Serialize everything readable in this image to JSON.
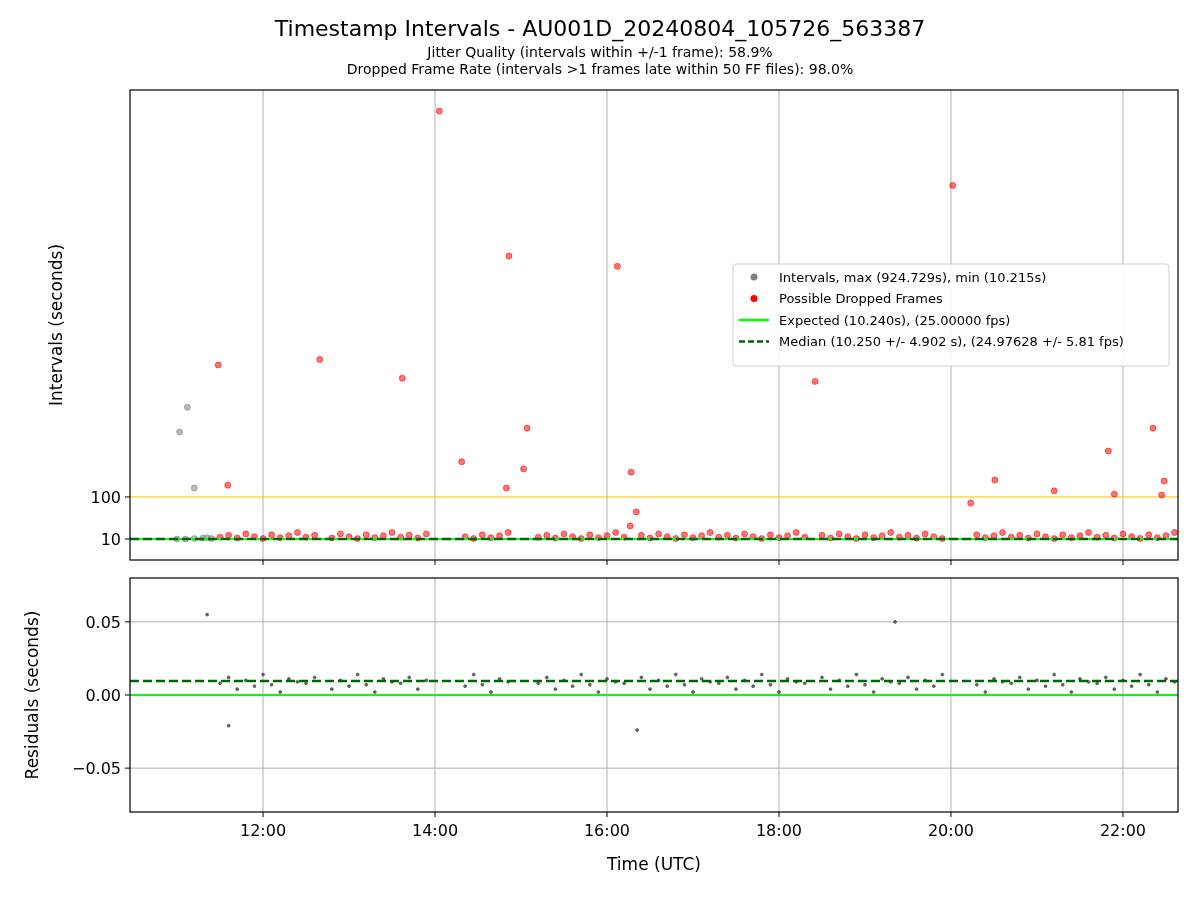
{
  "figure": {
    "title": "Timestamp Intervals - AU001D_20240804_105726_563387",
    "subtitle_lines": [
      "Jitter Quality (intervals within +/-1 frame): 58.9%",
      "Dropped Frame Rate (intervals >1 frames late within 50 FF files): 98.0%"
    ]
  },
  "intervals_plot": {
    "chart_data": {
      "type": "scatter",
      "ylabel": "Intervals (seconds)",
      "xlim": [
        10.453,
        22.64
      ],
      "ylim": [
        -34.8,
        970
      ],
      "yticks": [
        10,
        100
      ],
      "series": [
        {
          "name": "Intervals, max (924.729s), min (10.215s)",
          "color": "#808080",
          "x": [
            11.0,
            11.1,
            11.2,
            11.3,
            11.35,
            11.4,
            11.03,
            11.12,
            11.2
          ],
          "values": [
            10,
            10,
            11,
            12,
            13,
            11,
            239,
            292,
            119
          ]
        },
        {
          "name": "Possible Dropped Frames",
          "color": "#ff0000",
          "x": [
            11.5,
            11.6,
            11.7,
            11.8,
            11.9,
            12.0,
            12.1,
            12.2,
            12.3,
            12.4,
            12.5,
            12.6,
            12.8,
            12.9,
            13.0,
            13.1,
            13.2,
            13.3,
            13.4,
            13.5,
            13.6,
            13.7,
            13.8,
            13.9,
            14.35,
            14.45,
            14.55,
            14.65,
            14.75,
            14.85,
            15.2,
            15.3,
            15.4,
            15.5,
            15.6,
            15.7,
            15.8,
            15.9,
            16.0,
            16.1,
            16.2,
            16.4,
            16.5,
            16.6,
            16.7,
            16.8,
            16.9,
            17.0,
            17.1,
            17.2,
            17.3,
            17.4,
            17.5,
            17.6,
            17.7,
            17.8,
            17.9,
            18.0,
            18.1,
            18.2,
            18.3,
            18.5,
            18.6,
            18.7,
            18.8,
            18.9,
            19.0,
            19.1,
            19.2,
            19.3,
            19.4,
            19.5,
            19.6,
            19.7,
            19.8,
            19.9,
            20.3,
            20.4,
            20.5,
            20.6,
            20.7,
            20.8,
            20.9,
            21.0,
            21.1,
            21.2,
            21.3,
            21.4,
            21.5,
            21.6,
            21.7,
            21.8,
            21.9,
            22.0,
            22.1,
            22.2,
            22.3,
            22.4,
            22.5,
            22.6,
            11.48,
            11.59,
            12.66,
            13.62,
            14.05,
            14.31,
            14.83,
            14.86,
            15.03,
            15.07,
            16.12,
            16.28,
            16.27,
            16.34,
            18.42,
            20.02,
            20.23,
            20.51,
            21.2,
            21.83,
            21.9,
            22.35,
            22.48,
            22.45
          ],
          "values": [
            14,
            18,
            12,
            21,
            15,
            11,
            19,
            13,
            17,
            24,
            14,
            18,
            12,
            21,
            15,
            11,
            19,
            13,
            17,
            24,
            14,
            18,
            12,
            21,
            15,
            11,
            19,
            13,
            17,
            24,
            14,
            18,
            12,
            21,
            15,
            11,
            19,
            13,
            17,
            24,
            14,
            18,
            12,
            21,
            15,
            11,
            19,
            13,
            17,
            24,
            14,
            18,
            12,
            21,
            15,
            11,
            19,
            13,
            17,
            24,
            14,
            18,
            12,
            21,
            15,
            11,
            19,
            13,
            17,
            24,
            14,
            18,
            12,
            21,
            15,
            11,
            19,
            13,
            17,
            24,
            14,
            18,
            12,
            21,
            15,
            11,
            19,
            13,
            17,
            24,
            14,
            18,
            12,
            21,
            15,
            11,
            19,
            13,
            17,
            24,
            382,
            125,
            394,
            354,
            925,
            175,
            119,
            615,
            160,
            247,
            593,
            153,
            38,
            68,
            347,
            766,
            87,
            136,
            113,
            198,
            106,
            247,
            134,
            104
          ]
        }
      ],
      "grid": "x",
      "legend": true,
      "ref_lines": [
        {
          "axis": "y",
          "value": 100,
          "color": "#ffc000"
        },
        {
          "axis": "y",
          "value": 10.24,
          "color": "#00ff00",
          "label": "Expected (10.240s), (25.00000 fps)"
        },
        {
          "axis": "y",
          "value": 10.25,
          "color": "#006400",
          "label": "Median (10.250 +/- 4.902 s), (24.97628 +/- 5.81 fps)"
        }
      ]
    }
  },
  "residuals_plot": {
    "chart_data": {
      "type": "scatter",
      "xlabel": "Time (UTC)",
      "ylabel": "Residuals (seconds)",
      "xlim": [
        10.453,
        22.64
      ],
      "ylim": [
        -0.08,
        0.08
      ],
      "xticks": [
        {
          "value": 12,
          "label": "12:00"
        },
        {
          "value": 14,
          "label": "14:00"
        },
        {
          "value": 16,
          "label": "16:00"
        },
        {
          "value": 18,
          "label": "18:00"
        },
        {
          "value": 20,
          "label": "20:00"
        },
        {
          "value": 22,
          "label": "22:00"
        }
      ],
      "yticks": [
        {
          "value": -0.05,
          "label": "−0.05"
        },
        {
          "value": 0,
          "label": "0.00"
        },
        {
          "value": 0.05,
          "label": "0.05"
        }
      ],
      "series": [
        {
          "color": "#555555",
          "x": [
            11.5,
            11.6,
            11.7,
            11.8,
            11.9,
            12.0,
            12.1,
            12.2,
            12.3,
            12.4,
            12.5,
            12.6,
            12.8,
            12.9,
            13.0,
            13.1,
            13.2,
            13.3,
            13.4,
            13.5,
            13.6,
            13.7,
            13.8,
            13.9,
            14.35,
            14.45,
            14.55,
            14.65,
            14.75,
            14.85,
            15.2,
            15.3,
            15.4,
            15.5,
            15.6,
            15.7,
            15.8,
            15.9,
            16.0,
            16.1,
            16.2,
            16.4,
            16.5,
            16.6,
            16.7,
            16.8,
            16.9,
            17.0,
            17.1,
            17.2,
            17.3,
            17.4,
            17.5,
            17.6,
            17.7,
            17.8,
            17.9,
            18.0,
            18.1,
            18.2,
            18.3,
            18.5,
            18.6,
            18.7,
            18.8,
            18.9,
            19.0,
            19.1,
            19.2,
            19.3,
            19.4,
            19.5,
            19.6,
            19.7,
            19.8,
            19.9,
            20.3,
            20.4,
            20.5,
            20.6,
            20.7,
            20.8,
            20.9,
            21.0,
            21.1,
            21.2,
            21.3,
            21.4,
            21.5,
            21.6,
            21.7,
            21.8,
            21.9,
            22.0,
            22.1,
            22.2,
            22.3,
            22.4,
            22.5,
            22.6,
            11.35,
            11.6,
            16.35,
            19.35
          ],
          "values": [
            0.008,
            0.012,
            0.004,
            0.01,
            0.006,
            0.014,
            0.007,
            0.002,
            0.011,
            0.009,
            0.008,
            0.012,
            0.004,
            0.01,
            0.006,
            0.014,
            0.007,
            0.002,
            0.011,
            0.009,
            0.008,
            0.012,
            0.004,
            0.01,
            0.006,
            0.014,
            0.007,
            0.002,
            0.011,
            0.009,
            0.008,
            0.012,
            0.004,
            0.01,
            0.006,
            0.014,
            0.007,
            0.002,
            0.011,
            0.009,
            0.008,
            0.012,
            0.004,
            0.01,
            0.006,
            0.014,
            0.007,
            0.002,
            0.011,
            0.009,
            0.008,
            0.012,
            0.004,
            0.01,
            0.006,
            0.014,
            0.007,
            0.002,
            0.011,
            0.009,
            0.008,
            0.012,
            0.004,
            0.01,
            0.006,
            0.014,
            0.007,
            0.002,
            0.011,
            0.009,
            0.008,
            0.012,
            0.004,
            0.01,
            0.006,
            0.014,
            0.007,
            0.002,
            0.011,
            0.009,
            0.008,
            0.012,
            0.004,
            0.01,
            0.006,
            0.014,
            0.007,
            0.002,
            0.011,
            0.009,
            0.008,
            0.012,
            0.004,
            0.01,
            0.006,
            0.014,
            0.007,
            0.002,
            0.011,
            0.009,
            0.055,
            -0.021,
            -0.024,
            0.05
          ]
        }
      ],
      "grid": "both",
      "ref_lines": [
        {
          "axis": "y",
          "value": 0,
          "color": "#00ff00"
        },
        {
          "axis": "y",
          "value": 0.0096,
          "color": "#006400"
        }
      ]
    }
  }
}
